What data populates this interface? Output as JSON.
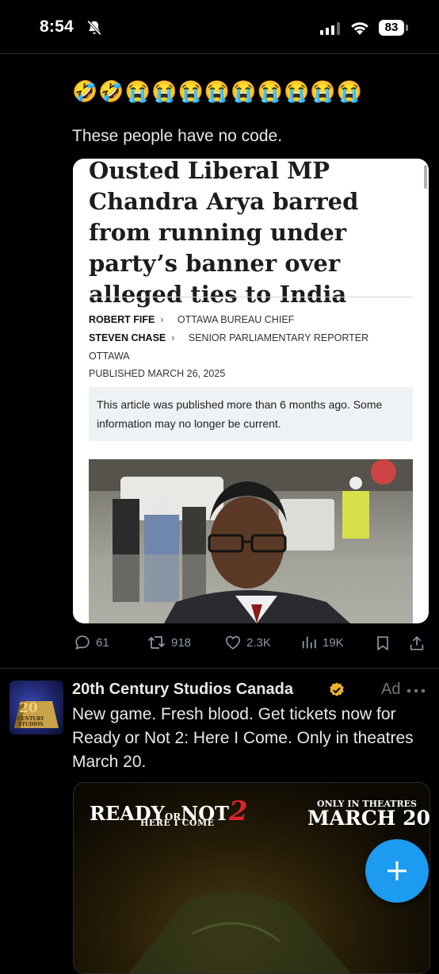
{
  "status_bar": {
    "time": "8:54",
    "battery": "83"
  },
  "tweet": {
    "emojis": "🤣🤣😭😭😭😭😭😭😭😭😭",
    "text": "These people have no code.",
    "article": {
      "headline": "Ousted Liberal MP Chandra Arya barred from running under party’s banner over alleged ties to India",
      "authors": [
        {
          "name": "ROBERT FIFE",
          "role": "OTTAWA BUREAU CHIEF"
        },
        {
          "name": "STEVEN CHASE",
          "role": "SENIOR PARLIAMENTARY REPORTER"
        }
      ],
      "location": "OTTAWA",
      "published": "PUBLISHED MARCH 26, 2025",
      "notice": "This article was published more than 6 months ago. Some information may no longer be current."
    },
    "actions": {
      "replies": "61",
      "retweets": "918",
      "likes": "2.3K",
      "views": "19K"
    }
  },
  "ad": {
    "account_name": "20th Century Studios Canada",
    "ad_label": "Ad",
    "text": "New game. Fresh blood. Get tickets now for Ready or Not 2: Here I Come. Only in theatres March 20.",
    "avatar_text": "20th Century Studios",
    "media": {
      "title_ready": "READY",
      "title_or": "OR",
      "title_not": "NOT",
      "title_2": "2",
      "subtitle": "HERE I COME",
      "only_in_theatres": "ONLY IN THEATRES",
      "date": "MARCH 20"
    }
  },
  "colors": {
    "accent": "#1d9bf0",
    "verified": "#e8b22c",
    "background": "#000000",
    "muted": "#8b98a5"
  }
}
